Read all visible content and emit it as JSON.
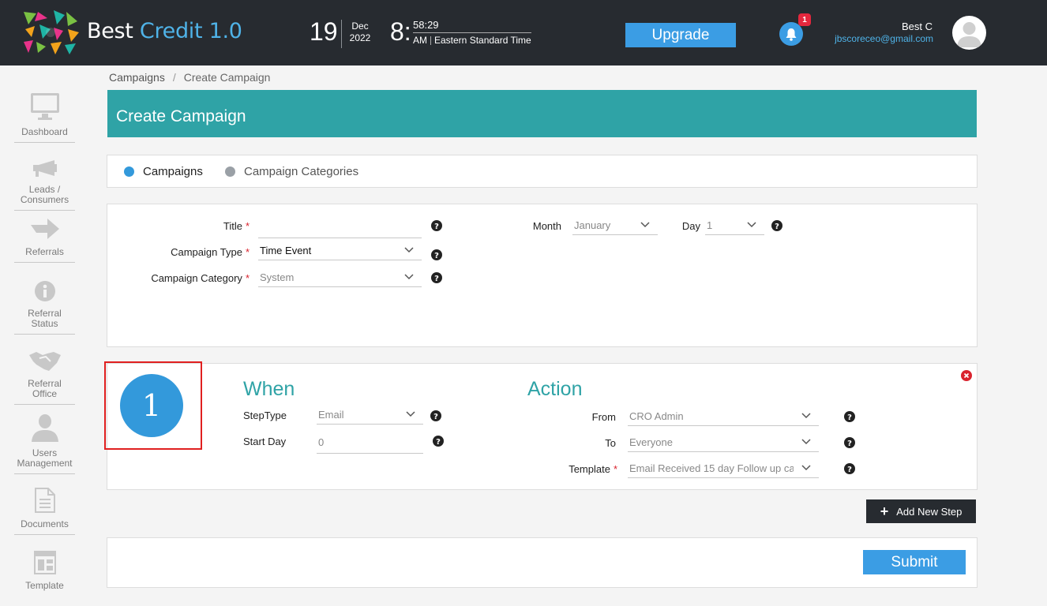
{
  "header": {
    "brand_main": "Best",
    "brand_accent": "Credit 1.0",
    "date_day": "19",
    "date_month": "Dec",
    "date_year": "2022",
    "time_hour": "8:",
    "time_min_sec": "58:29",
    "time_ampm": "AM",
    "time_zone": "Eastern Standard Time",
    "upgrade_label": "Upgrade",
    "notification_count": "1",
    "user_name": "Best C",
    "user_email": "jbscoreceo@gmail.com"
  },
  "sidebar": {
    "items": [
      {
        "label": "Dashboard",
        "icon": "monitor-icon"
      },
      {
        "label": "Leads /\nConsumers",
        "icon": "megaphone-icon"
      },
      {
        "label": "Referrals",
        "icon": "arrow-right-icon"
      },
      {
        "label": "Referral\nStatus",
        "icon": "info-icon"
      },
      {
        "label": "Referral\nOffice",
        "icon": "handshake-icon"
      },
      {
        "label": "Users\nManagement",
        "icon": "user-icon"
      },
      {
        "label": "Documents",
        "icon": "document-icon"
      },
      {
        "label": "Template",
        "icon": "template-icon"
      }
    ]
  },
  "breadcrumb": {
    "parent": "Campaigns",
    "separator": "/",
    "current": "Create Campaign"
  },
  "page_title": "Create Campaign",
  "tabs": {
    "campaigns": "Campaigns",
    "campaign_categories": "Campaign Categories",
    "active_color": "#3399db",
    "inactive_color": "#9aa0a6"
  },
  "form": {
    "title_label": "Title",
    "title_value": "",
    "campaign_type_label": "Campaign Type",
    "campaign_type_value": "Time Event",
    "campaign_category_label": "Campaign Category",
    "campaign_category_value": "System",
    "month_label": "Month",
    "month_value": "January",
    "day_label": "Day",
    "day_value": "1",
    "required_mark": "*"
  },
  "step": {
    "number": "1",
    "when_title": "When",
    "steptype_label": "StepType",
    "steptype_value": "Email",
    "startday_label": "Start Day",
    "startday_placeholder": "0",
    "action_title": "Action",
    "from_label": "From",
    "from_value": "CRO Admin",
    "to_label": "To",
    "to_value": "Everyone",
    "template_label": "Template",
    "template_value": "Email Received 15 day Follow up ca"
  },
  "buttons": {
    "add_new_step": "Add New Step",
    "submit": "Submit"
  },
  "colors": {
    "topbar": "#272b30",
    "teal": "#2fa3a6",
    "blue": "#3b9de4",
    "badge_red": "#e4273d"
  }
}
